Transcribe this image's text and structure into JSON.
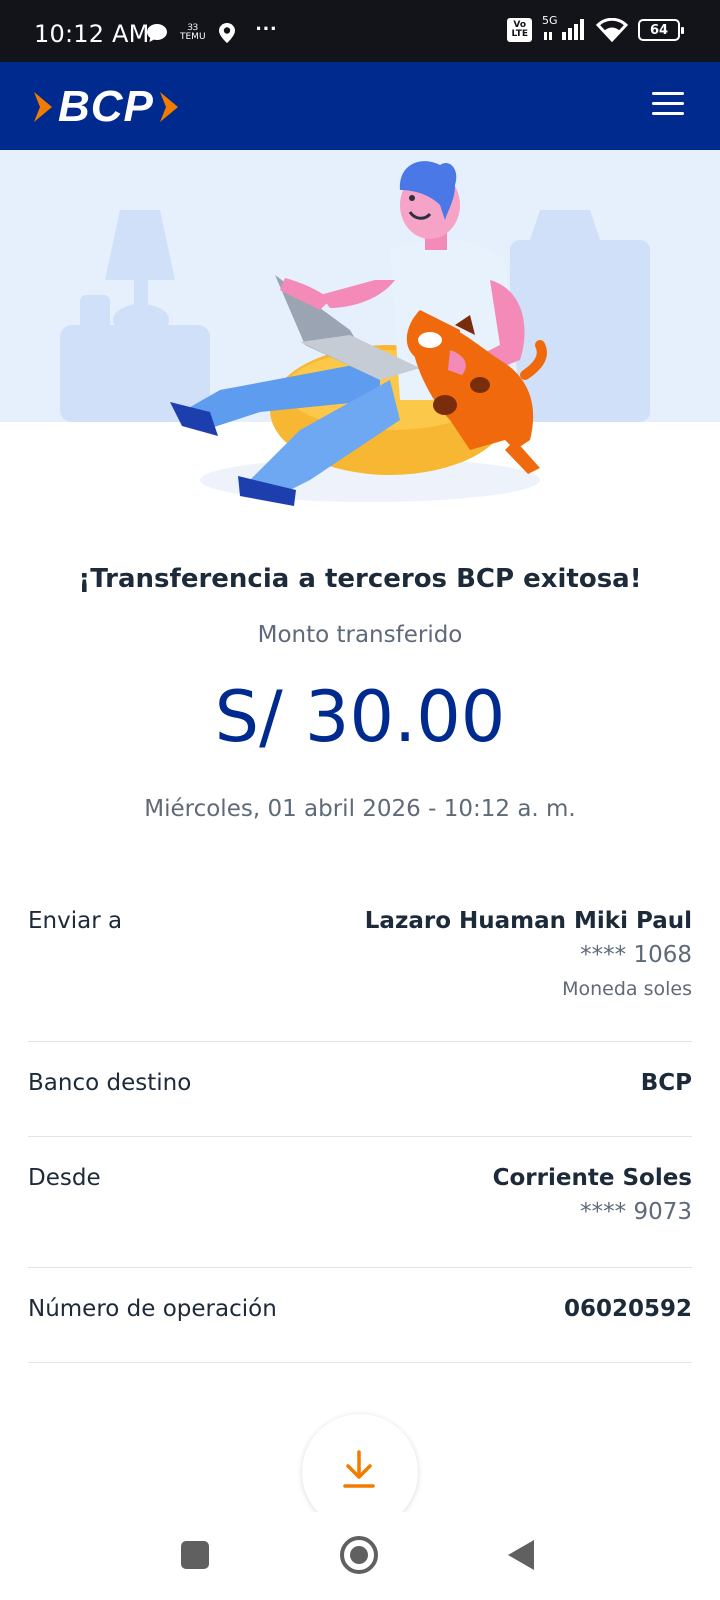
{
  "status_bar": {
    "time": "10:12 AM",
    "temu_label_top": "ꞫꞫ",
    "temu_label": "TEMU",
    "more": "···",
    "volte_top": "Vo",
    "volte_bottom": "LTE",
    "network": "5G",
    "battery": "64"
  },
  "header": {
    "brand": "BCP",
    "menu_icon": "hamburger-icon"
  },
  "transfer": {
    "title": "¡Transferencia a terceros BCP exitosa!",
    "amount_label": "Monto transferido",
    "amount": "S/ 30.00",
    "datetime": "Miércoles, 01 abril 2026 - 10:12 a. m."
  },
  "details": {
    "send_to": {
      "label": "Enviar a",
      "name": "Lazaro Huaman Miki Paul",
      "account": "**** 1068",
      "currency": "Moneda soles"
    },
    "bank": {
      "label": "Banco destino",
      "value": "BCP"
    },
    "from": {
      "label": "Desde",
      "account_type": "Corriente Soles",
      "account": "**** 9073"
    },
    "operation": {
      "label": "Número de operación",
      "value": "06020592"
    }
  },
  "actions": {
    "download_icon": "download-icon"
  },
  "colors": {
    "brand_blue": "#002a8d",
    "accent_orange": "#f27c00",
    "status_bar": "#13131a"
  }
}
